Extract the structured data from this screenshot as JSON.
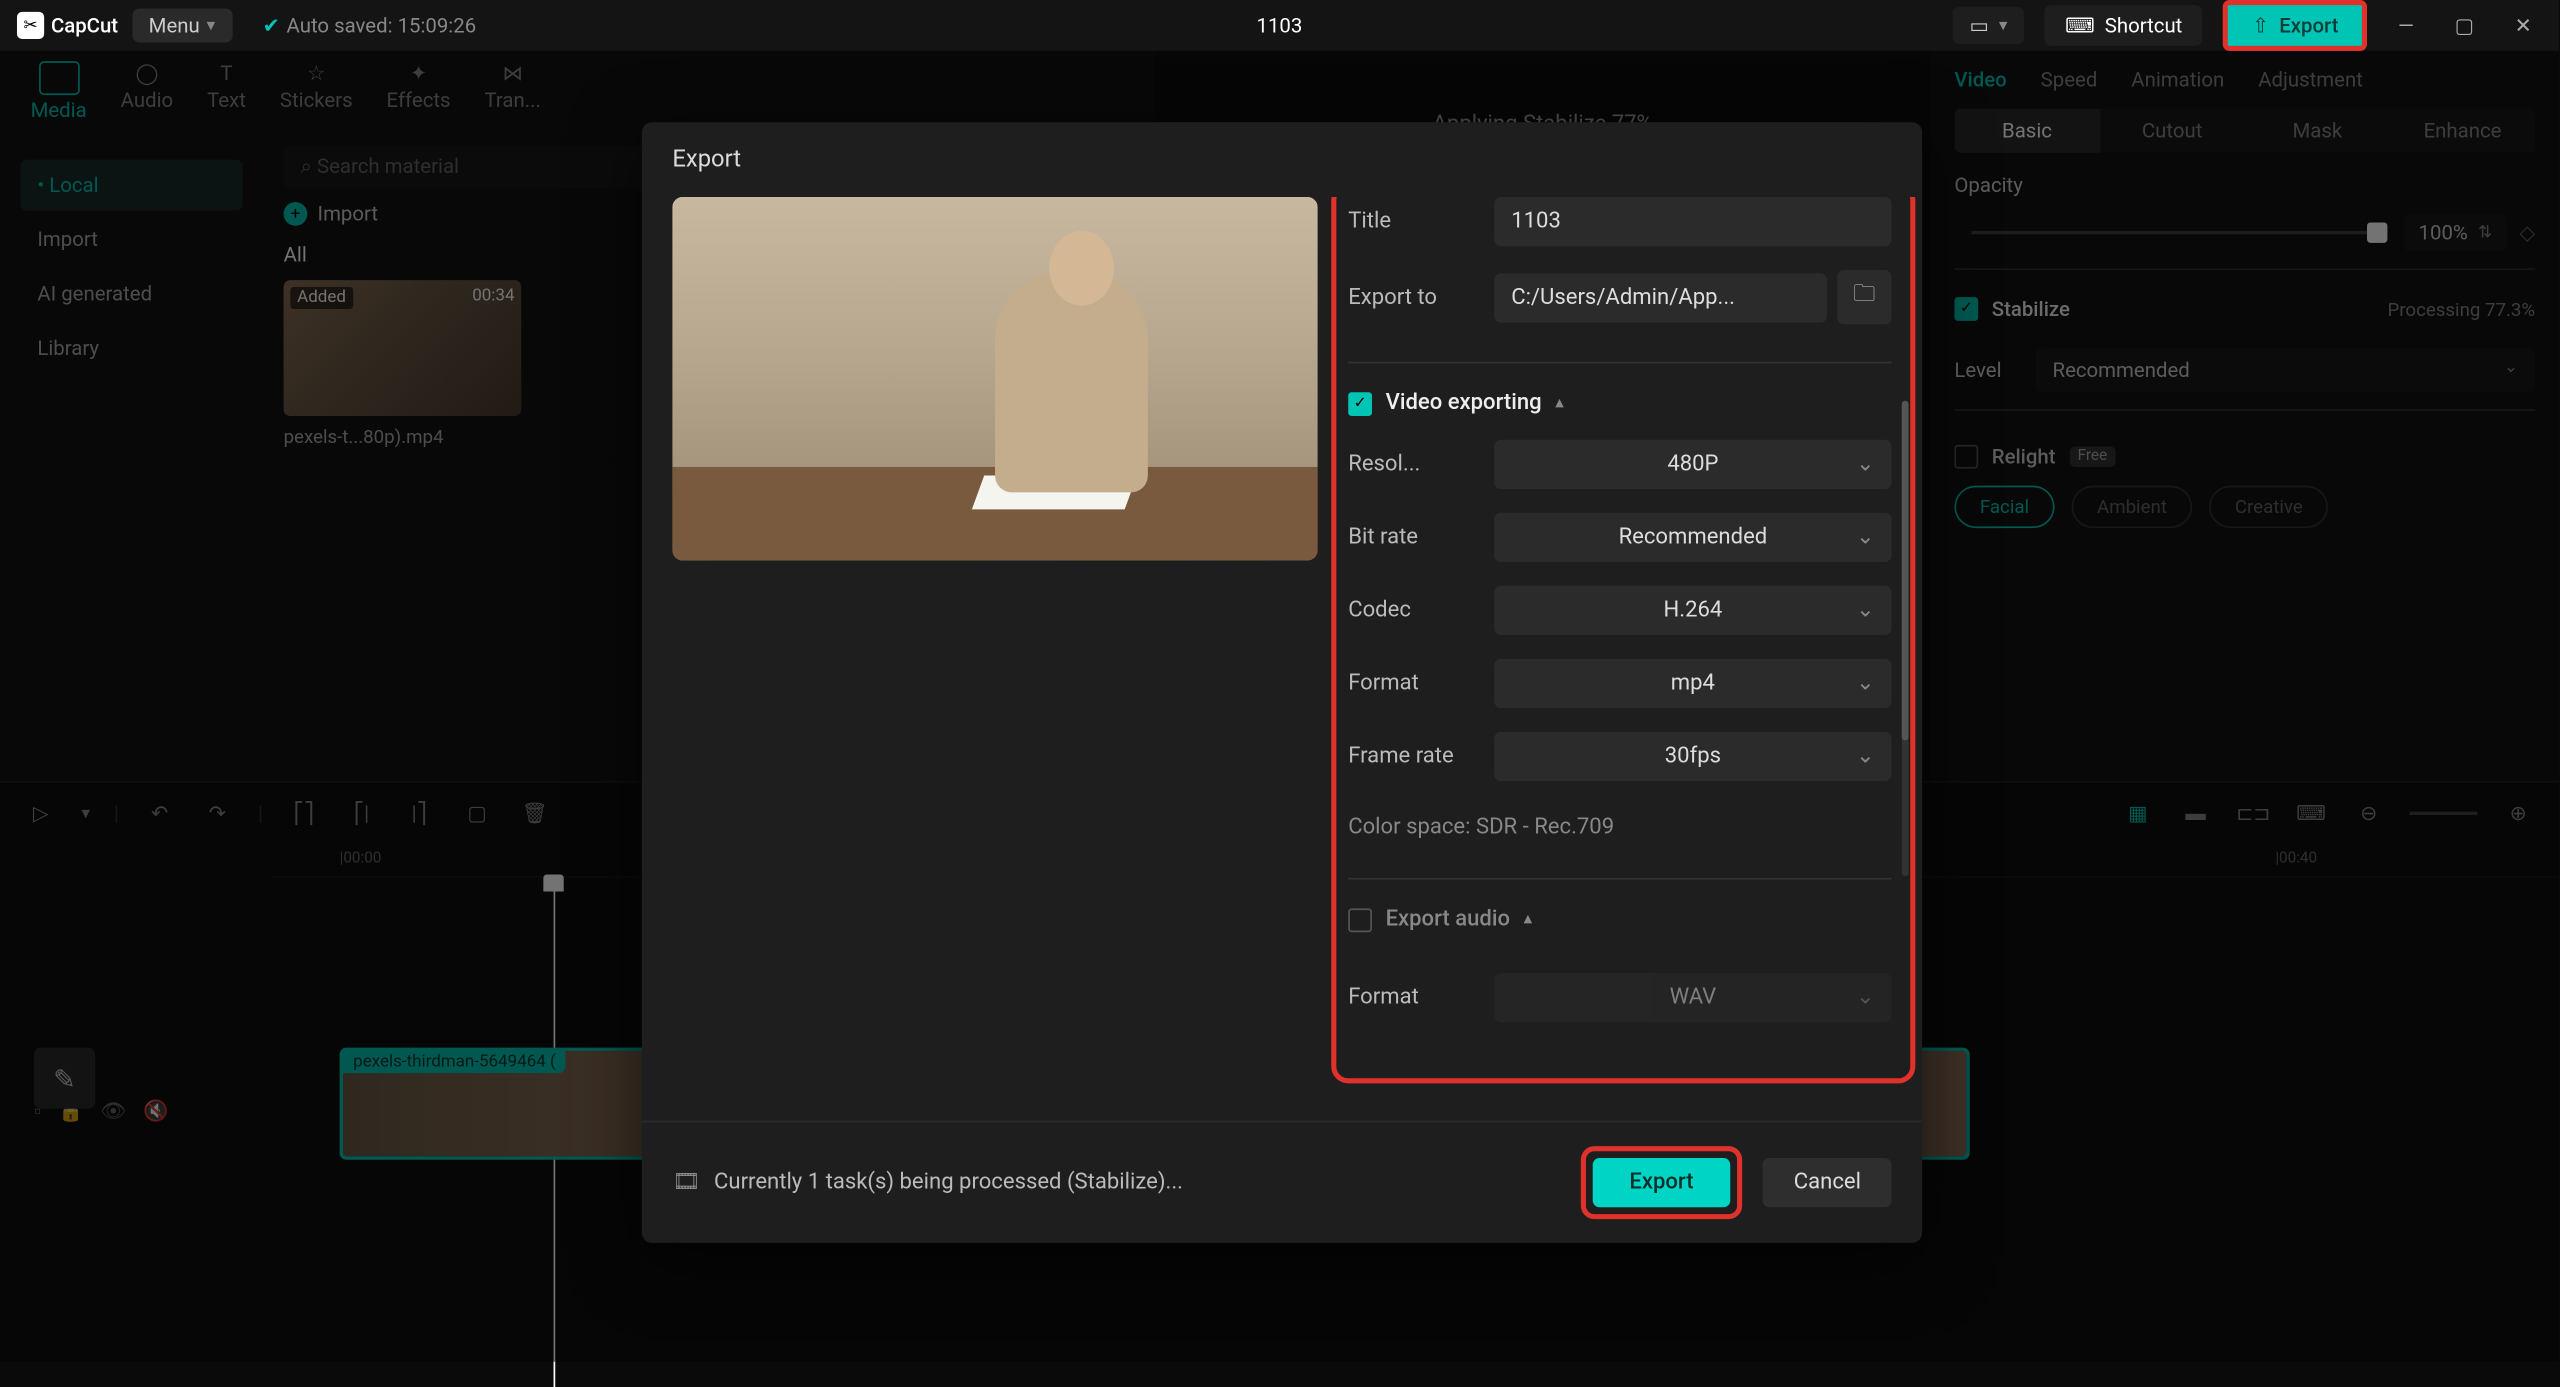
{
  "topbar": {
    "brand": "CapCut",
    "menu": "Menu",
    "autosave": "Auto saved: 15:09:26",
    "project": "1103",
    "shortcut": "Shortcut",
    "export": "Export"
  },
  "tabs": {
    "media": "Media",
    "audio": "Audio",
    "text": "Text",
    "stickers": "Stickers",
    "effects": "Effects",
    "transitions": "Tran..."
  },
  "sidebar": {
    "local": "• Local",
    "import": "Import",
    "ai": "AI generated",
    "library": "Library"
  },
  "media": {
    "search_placeholder": "Search material",
    "import_btn": "Import",
    "all": "All",
    "thumb_badge": "Added",
    "thumb_duration": "00:34",
    "thumb_name": "pexels-t...80p).mp4"
  },
  "preview": {
    "applying": "Applying Stabilize  77%"
  },
  "rightpanel": {
    "tabs": {
      "video": "Video",
      "speed": "Speed",
      "animation": "Animation",
      "adjustment": "Adjustment"
    },
    "subtabs": {
      "basic": "Basic",
      "cutout": "Cutout",
      "mask": "Mask",
      "enhance": "Enhance"
    },
    "opacity_label": "Opacity",
    "opacity_value": "100%",
    "stabilize": "Stabilize",
    "processing": "Processing 77.3%",
    "level": "Level",
    "level_value": "Recommended",
    "relight": "Relight",
    "free": "Free",
    "facial": "Facial",
    "ambient": "Ambient",
    "creative": "Creative"
  },
  "timeline": {
    "t0": "|00:00",
    "t1": "|00:40",
    "clip_name": "pexels-thirdman-5649464 ("
  },
  "modal": {
    "title": "Export",
    "fields": {
      "title_label": "Title",
      "title_value": "1103",
      "exportto_label": "Export to",
      "exportto_value": "C:/Users/Admin/App...",
      "video_exporting": "Video exporting",
      "resolution_label": "Resol...",
      "resolution_value": "480P",
      "bitrate_label": "Bit rate",
      "bitrate_value": "Recommended",
      "codec_label": "Codec",
      "codec_value": "H.264",
      "format_label": "Format",
      "format_value": "mp4",
      "framerate_label": "Frame rate",
      "framerate_value": "30fps",
      "colorspace": "Color space: SDR - Rec.709",
      "export_audio": "Export audio",
      "audio_format_label": "Format",
      "audio_format_value": "WAV"
    },
    "footer": {
      "status": "Currently 1 task(s) being processed (Stabilize)...",
      "export": "Export",
      "cancel": "Cancel"
    }
  }
}
